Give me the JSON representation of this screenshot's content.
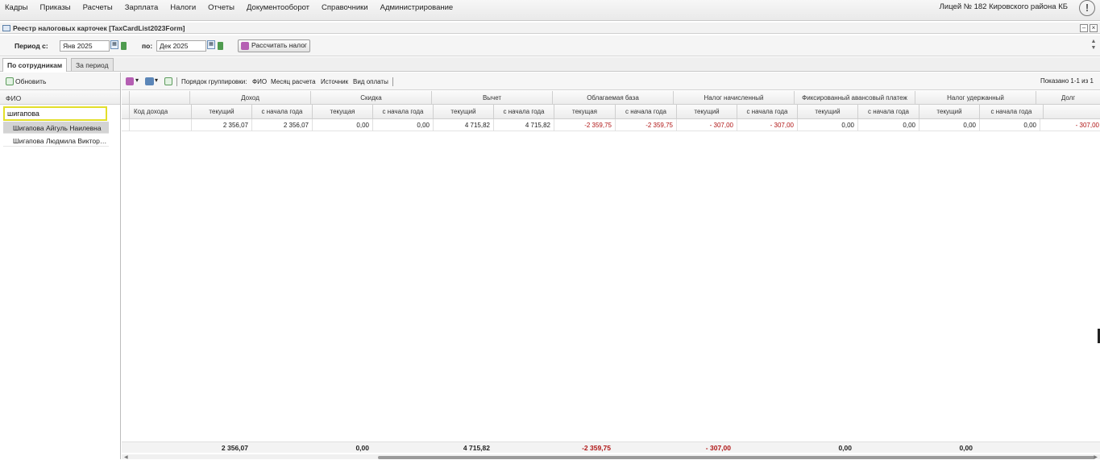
{
  "menu": [
    "Кадры",
    "Приказы",
    "Расчеты",
    "Зарплата",
    "Налоги",
    "Отчеты",
    "Документооборот",
    "Справочники",
    "Администрирование"
  ],
  "org_name": "Лицей № 182 Кировского района КБ",
  "info_icon": "!",
  "window": {
    "title": "Реестр налоговых карточек [TaxCardList2023Form]",
    "minimize": "–",
    "close": "×"
  },
  "period": {
    "from_label": "Период с:",
    "from_value": "Янв 2025",
    "to_label": "по:",
    "to_value": "Дек 2025",
    "calc_button": "Рассчитать налог"
  },
  "tabs": [
    "По сотрудникам",
    "За период"
  ],
  "left_panel": {
    "refresh_label": "Обновить",
    "column_header": "ФИО",
    "filter_value": "шигапова",
    "employees": [
      "Шигапова Айгуль Наилевна",
      "Шигапова Людмила Викторовна"
    ]
  },
  "grid_toolbar": {
    "grouping_label": "Порядок группировки:",
    "grouping_items": [
      "ФИО",
      "Месяц расчета",
      "Источник",
      "Вид оплаты"
    ],
    "shown_count": "Показано 1-1 из 1"
  },
  "grid": {
    "groups": [
      "Доход",
      "Скидка",
      "Вычет",
      "Облагаемая база",
      "Налог начисленный",
      "Фиксированный авансовый платеж",
      "Налог удержанный",
      "Долг"
    ],
    "code_header": "Код дохода",
    "sub_headers": [
      "текущий",
      "с начала года",
      "текущая",
      "с начала года",
      "текущий",
      "с начала года",
      "текущая",
      "с начала года",
      "текущий",
      "с начала года",
      "текущий",
      "с начала года",
      "текущий",
      "с начала года"
    ],
    "row": {
      "code": "",
      "values": [
        "2 356,07",
        "2 356,07",
        "0,00",
        "0,00",
        "4 715,82",
        "4 715,82",
        "-2 359,75",
        "-2 359,75",
        "- 307,00",
        "- 307,00",
        "0,00",
        "0,00",
        "0,00",
        "0,00",
        "- 307,00"
      ]
    },
    "totals": [
      "2 356,07",
      "0,00",
      "4 715,82",
      "-2 359,75",
      "- 307,00",
      "0,00",
      "0,00"
    ]
  },
  "colors": {
    "negative": "#b01515",
    "filter_border": "#e3df2a",
    "selected_row": "#d3d3d3"
  }
}
